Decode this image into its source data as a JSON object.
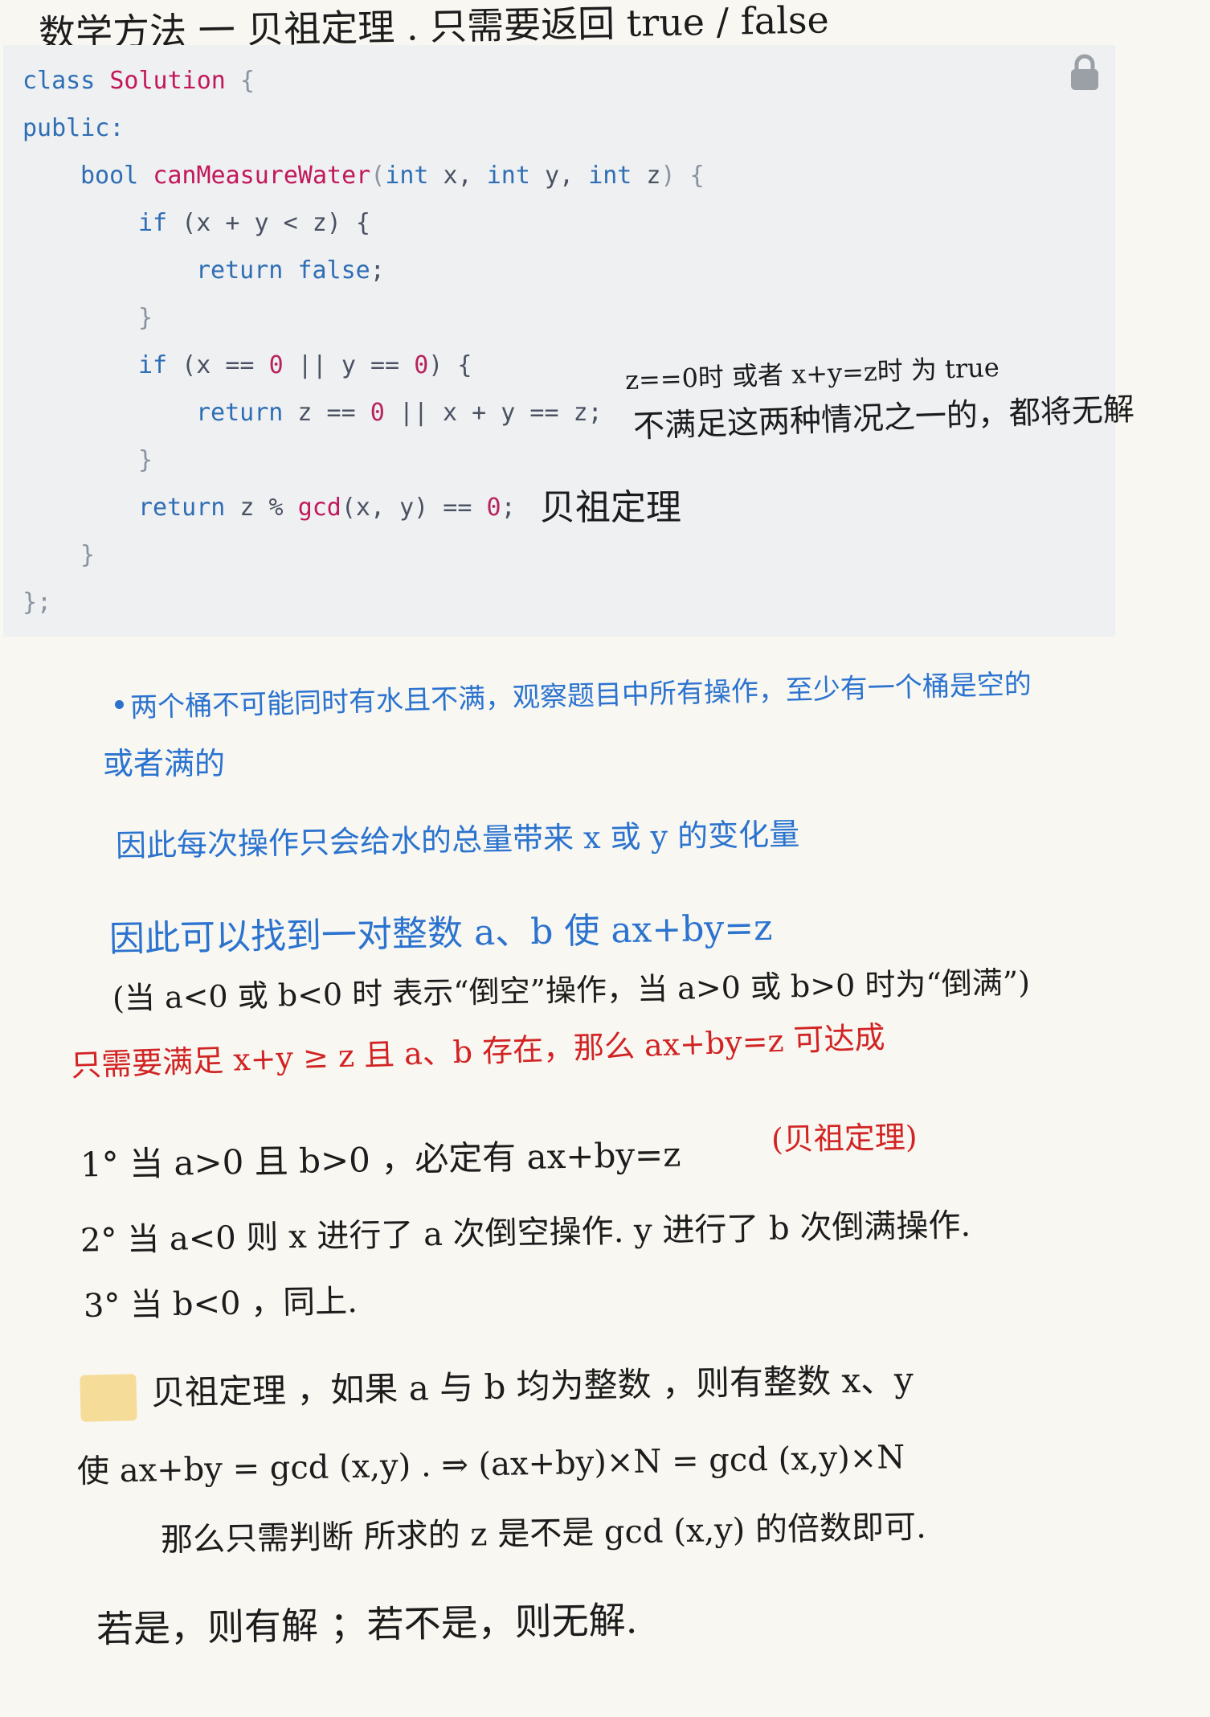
{
  "title": "数学方法 一 贝祖定理 . 只需要返回 true / false",
  "code": {
    "line1_kw": "class",
    "line1_name": "Solution",
    "line1_brace": "{",
    "line2": "public:",
    "line3_type": "bool",
    "line3_fn": "canMeasureWater",
    "line3_p1": "(",
    "line3_t1": "int",
    "line3_a1": " x, ",
    "line3_t2": "int",
    "line3_a2": " y, ",
    "line3_t3": "int",
    "line3_a3": " z",
    "line3_end": ") {",
    "line4_kw": "if",
    "line4_cond": " (x + y < z) {",
    "line5_kw": "return",
    "line5_bool": "false",
    "line5_semi": ";",
    "line6": "}",
    "line7_kw": "if",
    "line7_a": " (x == ",
    "line7_n1": "0",
    "line7_b": " || y == ",
    "line7_n2": "0",
    "line7_c": ") {",
    "line8_kw": "return",
    "line8_a": " z == ",
    "line8_n": "0",
    "line8_b": " || x + y == z;",
    "line9": "}",
    "line10_kw": "return",
    "line10_a": " z % ",
    "line10_fn": "gcd",
    "line10_b": "(x, y) == ",
    "line10_n": "0",
    "line10_c": ";",
    "line11": "}",
    "line12": "};"
  },
  "annotations": {
    "side_note_1": "z==0时 或者 x+y=z时 为 true",
    "side_note_2": "不满足这两种情况之一的，都将无解",
    "inline_note": "贝祖定理"
  },
  "notes": {
    "blue_1": "两个桶不可能同时有水且不满，观察题目中所有操作，至少有一个桶是空的",
    "blue_2": "或者满的",
    "blue_3": "因此每次操作只会给水的总量带来 x 或 y 的变化量",
    "blue_4": "因此可以找到一对整数 a、b  使 ax+by=z",
    "black_1": "(当 a<0 或 b<0 时 表示“倒空”操作，当 a>0 或 b>0 时为“倒满”)",
    "red_1": "只需要满足 x+y ≥ z 且 a、b 存在，那么 ax+by=z 可达成",
    "case_1": "1° 当 a>0 且 b>0 ，必定有 ax+by=z",
    "case_1_red": "(贝祖定理)",
    "case_2": "2° 当 a<0    则 x 进行了 a 次倒空操作. y 进行了 b 次倒满操作.",
    "case_3": "3° 当 b<0 ，同上.",
    "theorem_1": "贝祖定理 ，如果 a 与 b 均为整数 ，则有整数 x、y",
    "theorem_2": "使 ax+by = gcd (x,y) .  ⇒  (ax+by)×N = gcd (x,y)×N",
    "theorem_3": "那么只需判断 所求的 z 是不是 gcd (x,y) 的倍数即可.",
    "theorem_4": "若是，则有解 ；若不是，则无解."
  },
  "icon": "lock-icon",
  "colors": {
    "code_bg": "#eef0f2",
    "keyword": "#2f6eb5",
    "function": "#c2185b",
    "number": "#b8235e",
    "ink_black": "#1c1c1c",
    "ink_blue": "#2b73cf",
    "ink_red": "#d22323",
    "highlight": "#f5dc98"
  }
}
